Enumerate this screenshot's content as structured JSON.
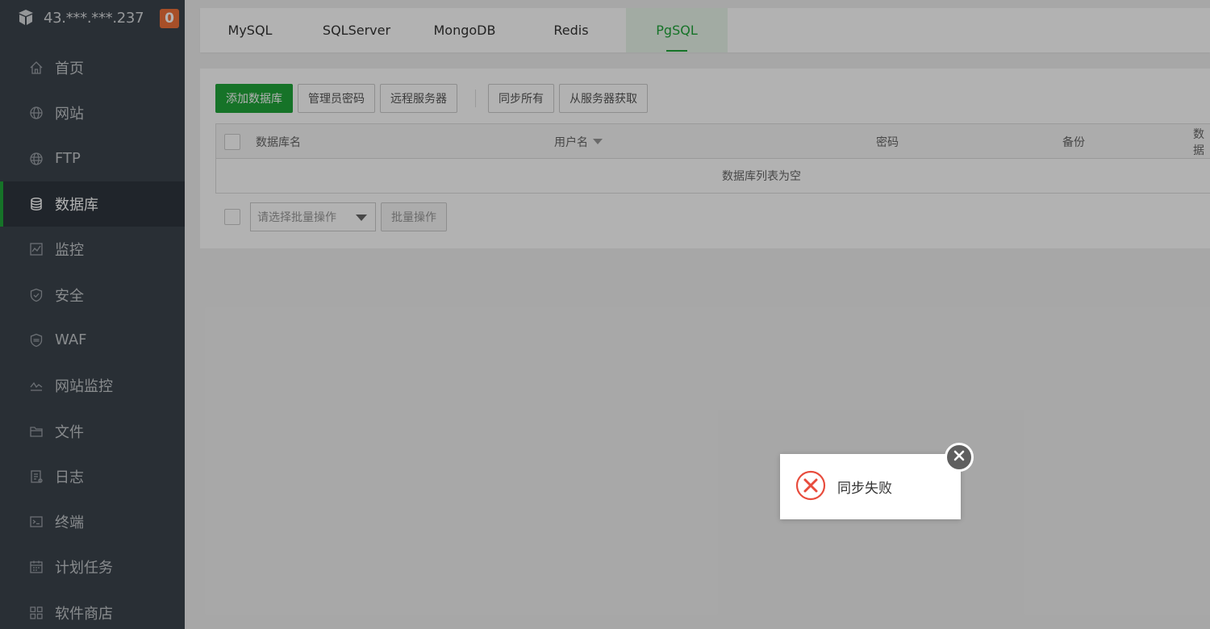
{
  "sidebar": {
    "server_ip": "43.***.***.237",
    "notification_count": "0",
    "items": [
      {
        "label": "首页",
        "icon": "home-icon"
      },
      {
        "label": "网站",
        "icon": "globe-icon"
      },
      {
        "label": "FTP",
        "icon": "ftp-icon"
      },
      {
        "label": "数据库",
        "icon": "database-icon",
        "active": true
      },
      {
        "label": "监控",
        "icon": "monitor-icon"
      },
      {
        "label": "安全",
        "icon": "shield-icon"
      },
      {
        "label": "WAF",
        "icon": "waf-icon"
      },
      {
        "label": "网站监控",
        "icon": "chart-line-icon"
      },
      {
        "label": "文件",
        "icon": "folder-icon"
      },
      {
        "label": "日志",
        "icon": "log-icon"
      },
      {
        "label": "终端",
        "icon": "terminal-icon"
      },
      {
        "label": "计划任务",
        "icon": "calendar-icon"
      },
      {
        "label": "软件商店",
        "icon": "apps-icon"
      }
    ]
  },
  "tabs": [
    {
      "label": "MySQL"
    },
    {
      "label": "SQLServer"
    },
    {
      "label": "MongoDB"
    },
    {
      "label": "Redis"
    },
    {
      "label": "PgSQL",
      "active": true
    }
  ],
  "toolbar": {
    "add_db": "添加数据库",
    "admin_password": "管理员密码",
    "remote_server": "远程服务器",
    "sync_all": "同步所有",
    "fetch_from_server": "从服务器获取"
  },
  "table": {
    "columns": [
      "数据库名",
      "用户名",
      "密码",
      "备份",
      "数据"
    ],
    "empty_text": "数据库列表为空"
  },
  "batch": {
    "select_placeholder": "请选择批量操作",
    "button": "批量操作"
  },
  "toast": {
    "message": "同步失败"
  },
  "colors": {
    "brand_green": "#20a53a",
    "sidebar_bg": "#3c444d",
    "badge_orange": "#f0713a",
    "error_red": "#e84c3d"
  }
}
